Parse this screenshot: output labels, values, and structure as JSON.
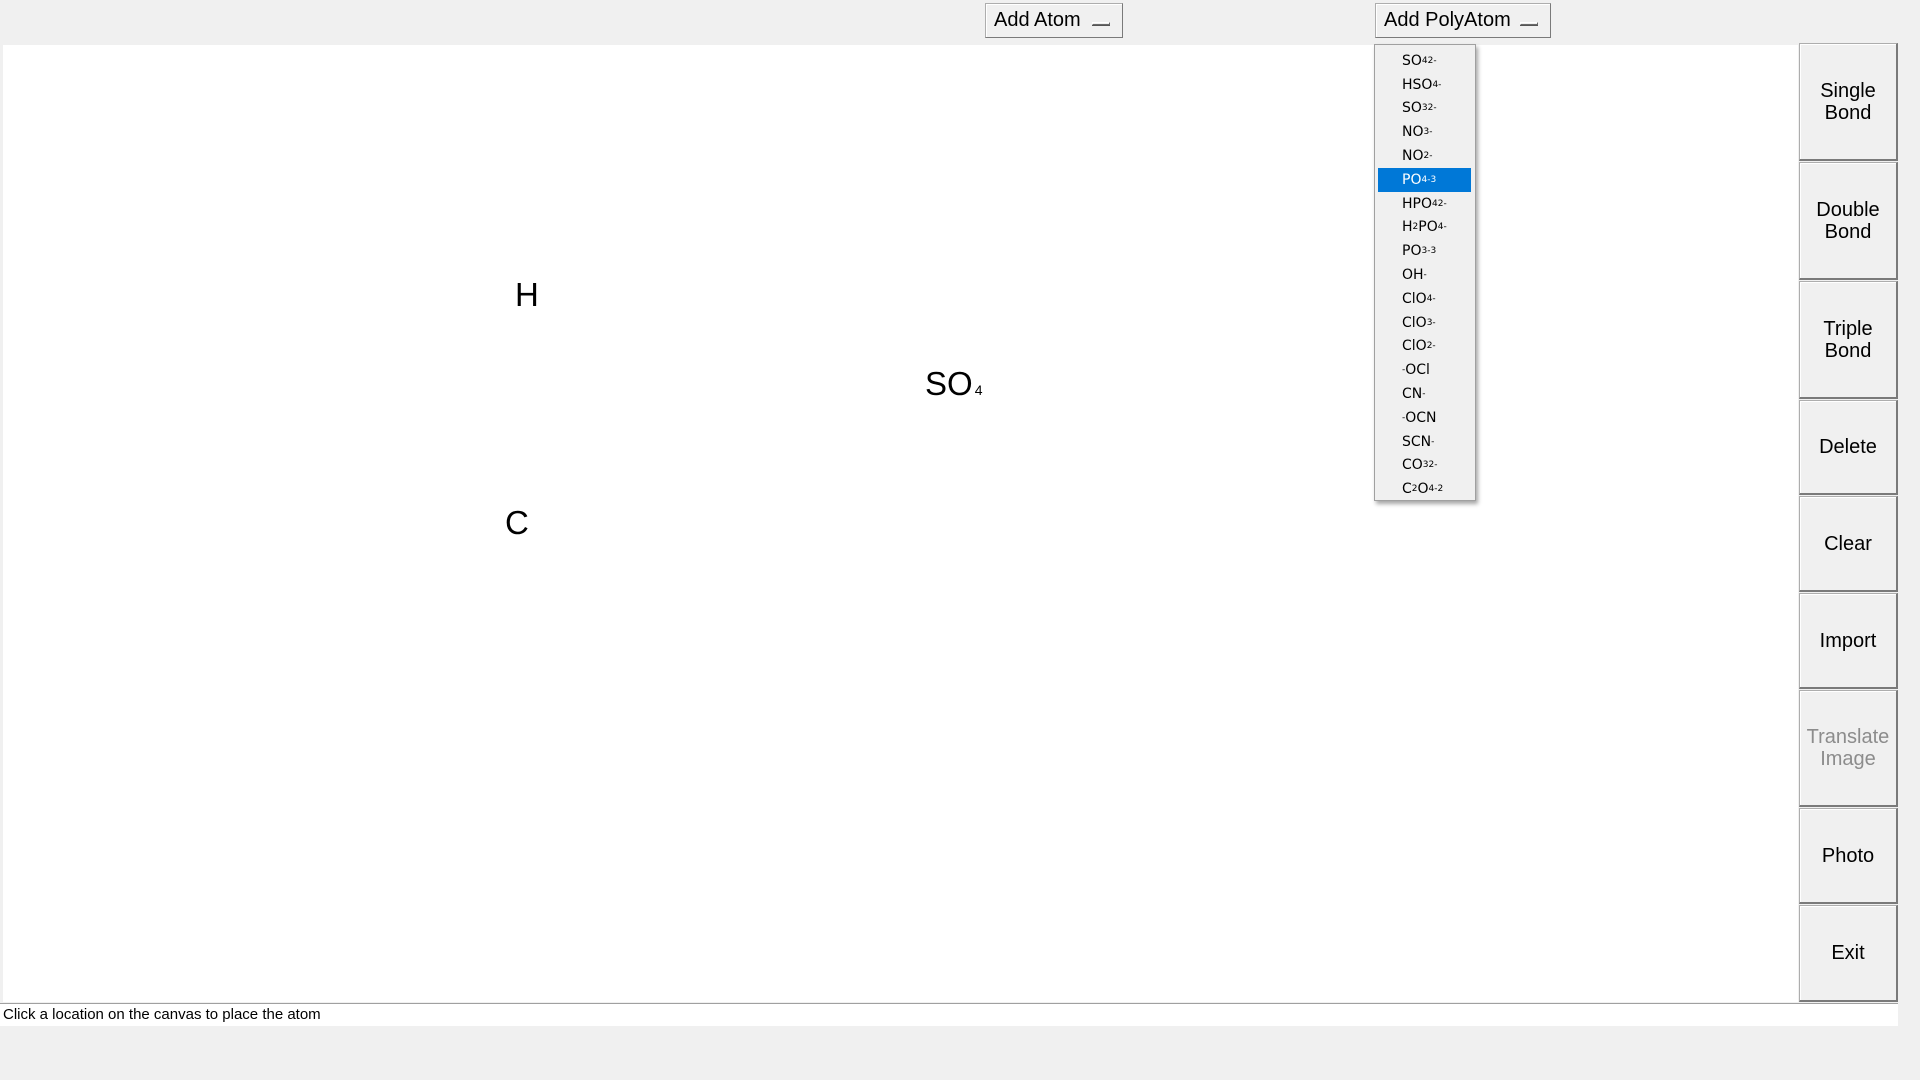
{
  "menus": {
    "add_atom": "Add Atom",
    "add_polyatom": "Add PolyAtom"
  },
  "canvas": {
    "atoms": [
      {
        "symbol": "H"
      },
      {
        "symbol": "C"
      },
      {
        "symbol": "SO",
        "subscript": "4"
      }
    ]
  },
  "polyatom_dropdown": {
    "selected_index": 5,
    "items": [
      {
        "base": "SO",
        "sub": "4",
        "charge": "2-"
      },
      {
        "base": "HSO",
        "sub": "4",
        "charge": "-"
      },
      {
        "base": "SO",
        "sub": "3",
        "charge": "2-"
      },
      {
        "base": "NO",
        "sub": "3",
        "charge": "-"
      },
      {
        "base": "NO",
        "sub": "2",
        "charge": "-"
      },
      {
        "base": "PO",
        "sub": "4",
        "charge": "-3"
      },
      {
        "base": "HPO",
        "sub": "4",
        "charge": "2-"
      },
      {
        "base": "H",
        "sub": "2",
        "base2": "PO",
        "sub2": "4",
        "charge": "-"
      },
      {
        "base": "PO",
        "sub": "3",
        "charge": "-3"
      },
      {
        "base": "OH",
        "charge": "-"
      },
      {
        "base": "ClO",
        "sub": "4",
        "charge": "-"
      },
      {
        "base": "ClO",
        "sub": "3",
        "charge": "-"
      },
      {
        "base": "ClO",
        "sub": "2",
        "charge": "-"
      },
      {
        "prefix_charge": "-",
        "base": "OCl"
      },
      {
        "base": "CN",
        "charge": "-"
      },
      {
        "prefix_charge": "-",
        "base": "OCN"
      },
      {
        "base": "SCN",
        "charge": "-"
      },
      {
        "base": "CO",
        "sub": "3",
        "charge": "2-"
      },
      {
        "base": "C",
        "sub": "2",
        "base2": "O",
        "sub2": "4",
        "charge": "-2"
      }
    ]
  },
  "toolbar": {
    "buttons": [
      {
        "label": "Single\nBond",
        "enabled": true
      },
      {
        "label": "Double\nBond",
        "enabled": true
      },
      {
        "label": "Triple\nBond",
        "enabled": true
      },
      {
        "label": "Delete",
        "enabled": true
      },
      {
        "label": "Clear",
        "enabled": true
      },
      {
        "label": "Import",
        "enabled": true
      },
      {
        "label": "Translate\nImage",
        "enabled": false
      },
      {
        "label": "Photo",
        "enabled": true
      },
      {
        "label": "Exit",
        "enabled": true
      }
    ]
  },
  "status": {
    "text": "Click a location on the canvas to place the atom"
  },
  "colors": {
    "selection": "#0078d7",
    "window_bg": "#f0f0f0",
    "canvas_bg": "#ffffff",
    "disabled_text": "#8c8c8c"
  }
}
